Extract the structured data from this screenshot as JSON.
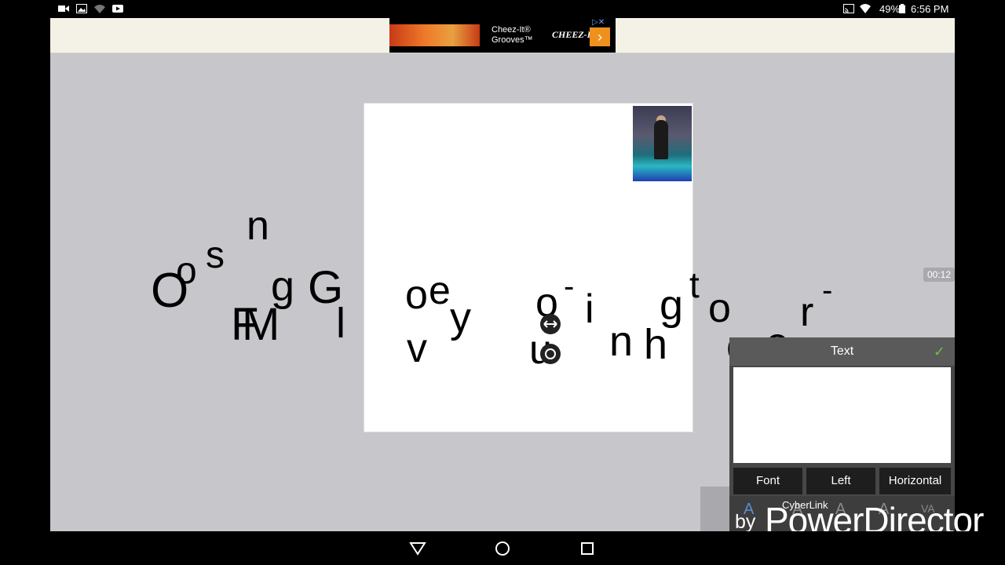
{
  "status_bar": {
    "battery": "49%",
    "time": "6:56 PM"
  },
  "ad": {
    "product_line1": "Cheez-It®",
    "product_line2": "Grooves™",
    "brand": "CHEEZ-IT",
    "arrow": "›",
    "info": "▷✕"
  },
  "timer": "00:12",
  "canvas_letters": [
    "n",
    "s",
    "o",
    "O",
    "g",
    "G",
    "F",
    "M",
    "l",
    "e",
    "o",
    "y",
    "v",
    "o",
    "-",
    "i",
    "u",
    "n",
    "h",
    "t",
    "g",
    "o",
    "c",
    "e",
    "r",
    "-"
  ],
  "text_panel": {
    "title": "Text",
    "confirm_icon": "✓",
    "buttons": {
      "font": "Font",
      "align": "Left",
      "direction": "Horizontal"
    },
    "tools": [
      "A",
      "A",
      "A",
      "A",
      "VA"
    ]
  },
  "watermark": {
    "brand_small": "CyberLink",
    "by": "by",
    "brand_big": "PowerDirector"
  },
  "nav": {
    "back_icon": "back-triangle-icon",
    "home_icon": "home-circle-icon",
    "recents_icon": "recents-square-icon"
  },
  "colors": {
    "workspace": "#c7c6cb",
    "panel": "#474747",
    "check": "#6fbf3f",
    "ad_accent": "#f0901c"
  }
}
